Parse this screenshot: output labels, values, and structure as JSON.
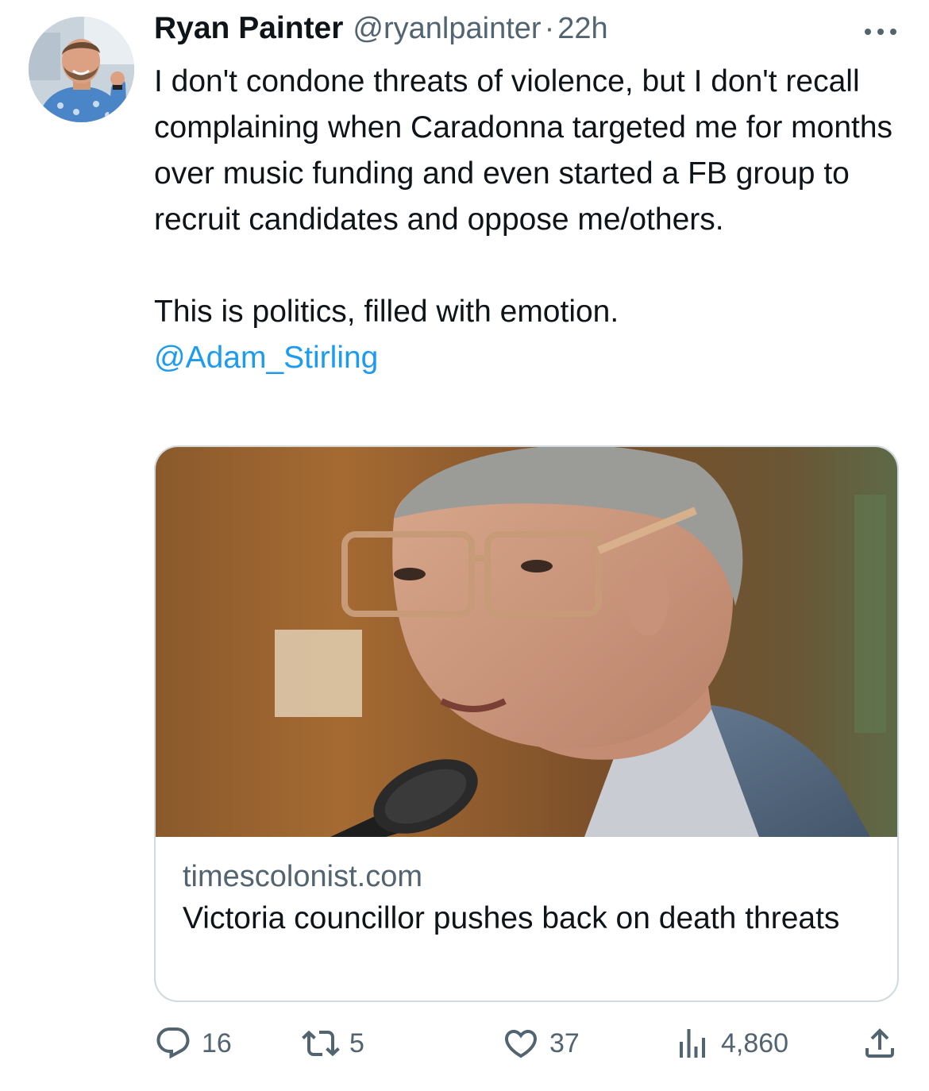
{
  "tweet": {
    "author": {
      "name": "Ryan Painter",
      "handle": "@ryanlpainter",
      "separator": "·",
      "time": "22h"
    },
    "text_lines": [
      "I don't condone threats of violence, but I don't recall complaining when Caradonna targeted me for months over music funding and even started a FB group to recruit candidates and oppose me/others.",
      "This is politics, filled with emotion."
    ],
    "mention": "@Adam_Stirling",
    "card": {
      "domain": "timescolonist.com",
      "title": "Victoria councillor pushes back on death threats"
    },
    "actions": {
      "replies": "16",
      "retweets": "5",
      "likes": "37",
      "views": "4,860"
    }
  },
  "icons": {
    "more": "more-icon",
    "reply": "reply-icon",
    "retweet": "retweet-icon",
    "like": "heart-icon",
    "views": "views-icon",
    "share": "share-icon"
  },
  "colors": {
    "text": "#0f1419",
    "secondary": "#536471",
    "link": "#1d9bf0",
    "border": "#cfd9de"
  }
}
